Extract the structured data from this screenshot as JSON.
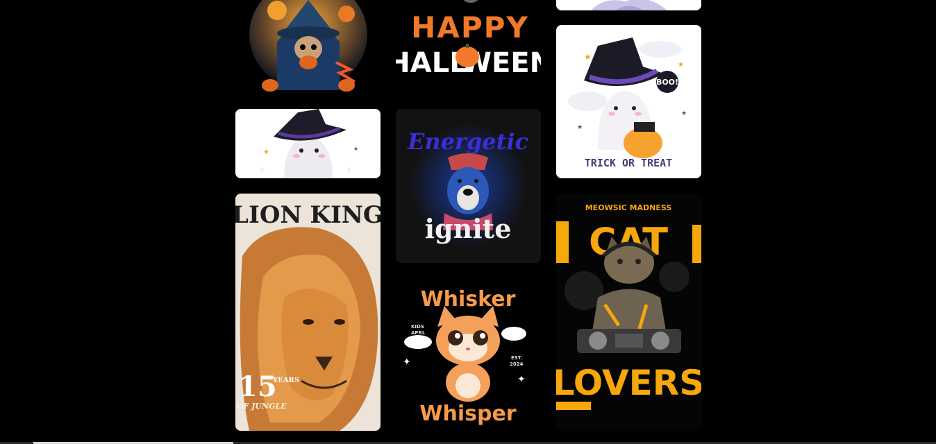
{
  "gallery": {
    "cards": [
      {
        "id": "reaper-pumpkin",
        "texts": []
      },
      {
        "id": "happy-halloween",
        "texts": [
          "HAPPY",
          "HALL",
          "WEEN"
        ]
      },
      {
        "id": "ghost-top-cropped",
        "texts": []
      },
      {
        "id": "ghost-witch-small",
        "texts": []
      },
      {
        "id": "energetic-ignite",
        "texts": [
          "Energetic",
          "ignite"
        ]
      },
      {
        "id": "trick-or-treat",
        "texts": [
          "TRICK OR TREAT",
          "BOO!"
        ]
      },
      {
        "id": "lion-king",
        "texts": [
          "LION KING",
          "15",
          "YEARS",
          "OF JUNGLE"
        ]
      },
      {
        "id": "whisker-whisper",
        "texts": [
          "Whisker",
          "Whisper",
          "KIDS",
          "APRL",
          "EST.",
          "2024"
        ]
      },
      {
        "id": "cat-lovers",
        "texts": [
          "MEOWSIC MADNESS",
          "CAT",
          "LOVERS"
        ]
      }
    ]
  },
  "colors": {
    "background": "#000000",
    "halloween_orange": "#f07a2a",
    "energetic_blue": "#3a2fd6",
    "whisker_orange": "#f79a4a",
    "cat_yellow": "#f5a70c",
    "trick_purple": "#4a3a7a"
  }
}
